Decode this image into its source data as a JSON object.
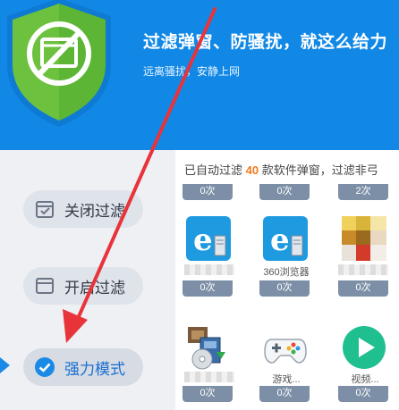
{
  "header": {
    "title": "过滤弹窗、防骚扰，就这么给力",
    "subtitle": "远离骚扰，安静上网",
    "bg_color": "#1188e6",
    "shield_color": "#6cc13e"
  },
  "modes": [
    {
      "label": "关闭过滤",
      "icon": "checklist-icon"
    },
    {
      "label": "开启过滤",
      "icon": "window-icon"
    },
    {
      "label": "强力模式",
      "icon": "check-circle-icon",
      "active": true
    }
  ],
  "status": {
    "prefix": "已自动过滤 ",
    "count": "40",
    "suffix": " 款软件弹窗，过滤非弓"
  },
  "apps": {
    "row0_counts": [
      "0次",
      "0次",
      "2次"
    ],
    "row1": [
      {
        "icon": "ie-browser-icon",
        "name": "...",
        "count": "0次"
      },
      {
        "icon": "ie-browser-icon",
        "name": "360浏览器",
        "count": "0次"
      },
      {
        "icon": "pixelated-app-icon",
        "name": "",
        "count": "0次"
      }
    ],
    "row2": [
      {
        "icon": "installer-disc-icon",
        "name": "",
        "count": "0次"
      },
      {
        "icon": "gamepad-icon",
        "name": "游戏...",
        "count": "0次"
      },
      {
        "icon": "video-play-icon",
        "name": "视频...",
        "count": "0次"
      }
    ]
  },
  "annotation_color": "#e8333a"
}
